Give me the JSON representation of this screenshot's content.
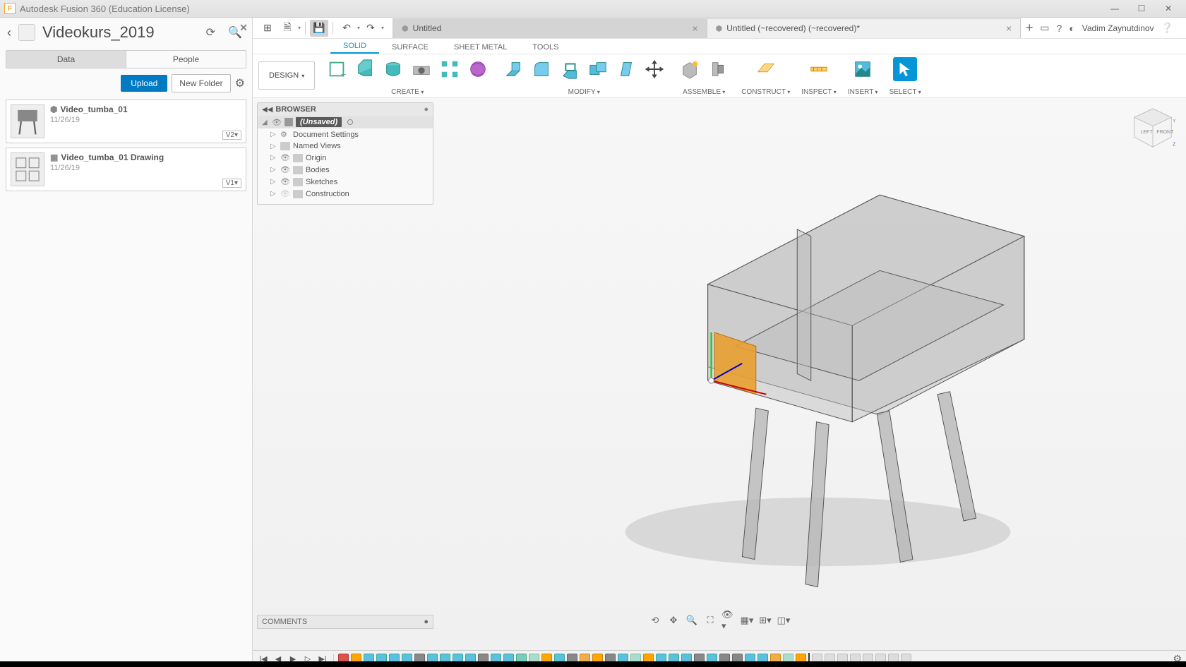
{
  "app_title": "Autodesk Fusion 360 (Education License)",
  "project": {
    "name": "Videokurs_2019"
  },
  "data_panel": {
    "tabs": [
      "Data",
      "People"
    ],
    "active_tab": 0,
    "upload": "Upload",
    "new_folder": "New Folder",
    "files": [
      {
        "name": "Video_tumba_01",
        "date": "11/26/19",
        "version": "V2▾",
        "thumb": "model"
      },
      {
        "name": "Video_tumba_01 Drawing",
        "date": "11/26/19",
        "version": "V1▾",
        "thumb": "drawing"
      }
    ]
  },
  "qat": {
    "grid": "⊞",
    "file": "🗎",
    "save": "💾",
    "undo": "↶",
    "redo": "↷"
  },
  "doc_tabs": [
    {
      "title": "Untitled",
      "active": true
    },
    {
      "title": "Untitled (~recovered) (~recovered)*",
      "active": false
    }
  ],
  "user": "Vadim Zaynutdinov",
  "workspace_mode": "DESIGN",
  "mode_tabs": [
    "SOLID",
    "SURFACE",
    "SHEET METAL",
    "TOOLS"
  ],
  "mode_active": 0,
  "ribbon_groups": [
    "CREATE",
    "MODIFY",
    "ASSEMBLE",
    "CONSTRUCT",
    "INSPECT",
    "INSERT",
    "SELECT"
  ],
  "browser": {
    "header": "BROWSER",
    "root": "(Unsaved)",
    "items": [
      "Document Settings",
      "Named Views",
      "Origin",
      "Bodies",
      "Sketches",
      "Construction"
    ]
  },
  "comments": "COMMENTS",
  "viewcube": {
    "left": "LEFT",
    "front": "FRONT"
  }
}
